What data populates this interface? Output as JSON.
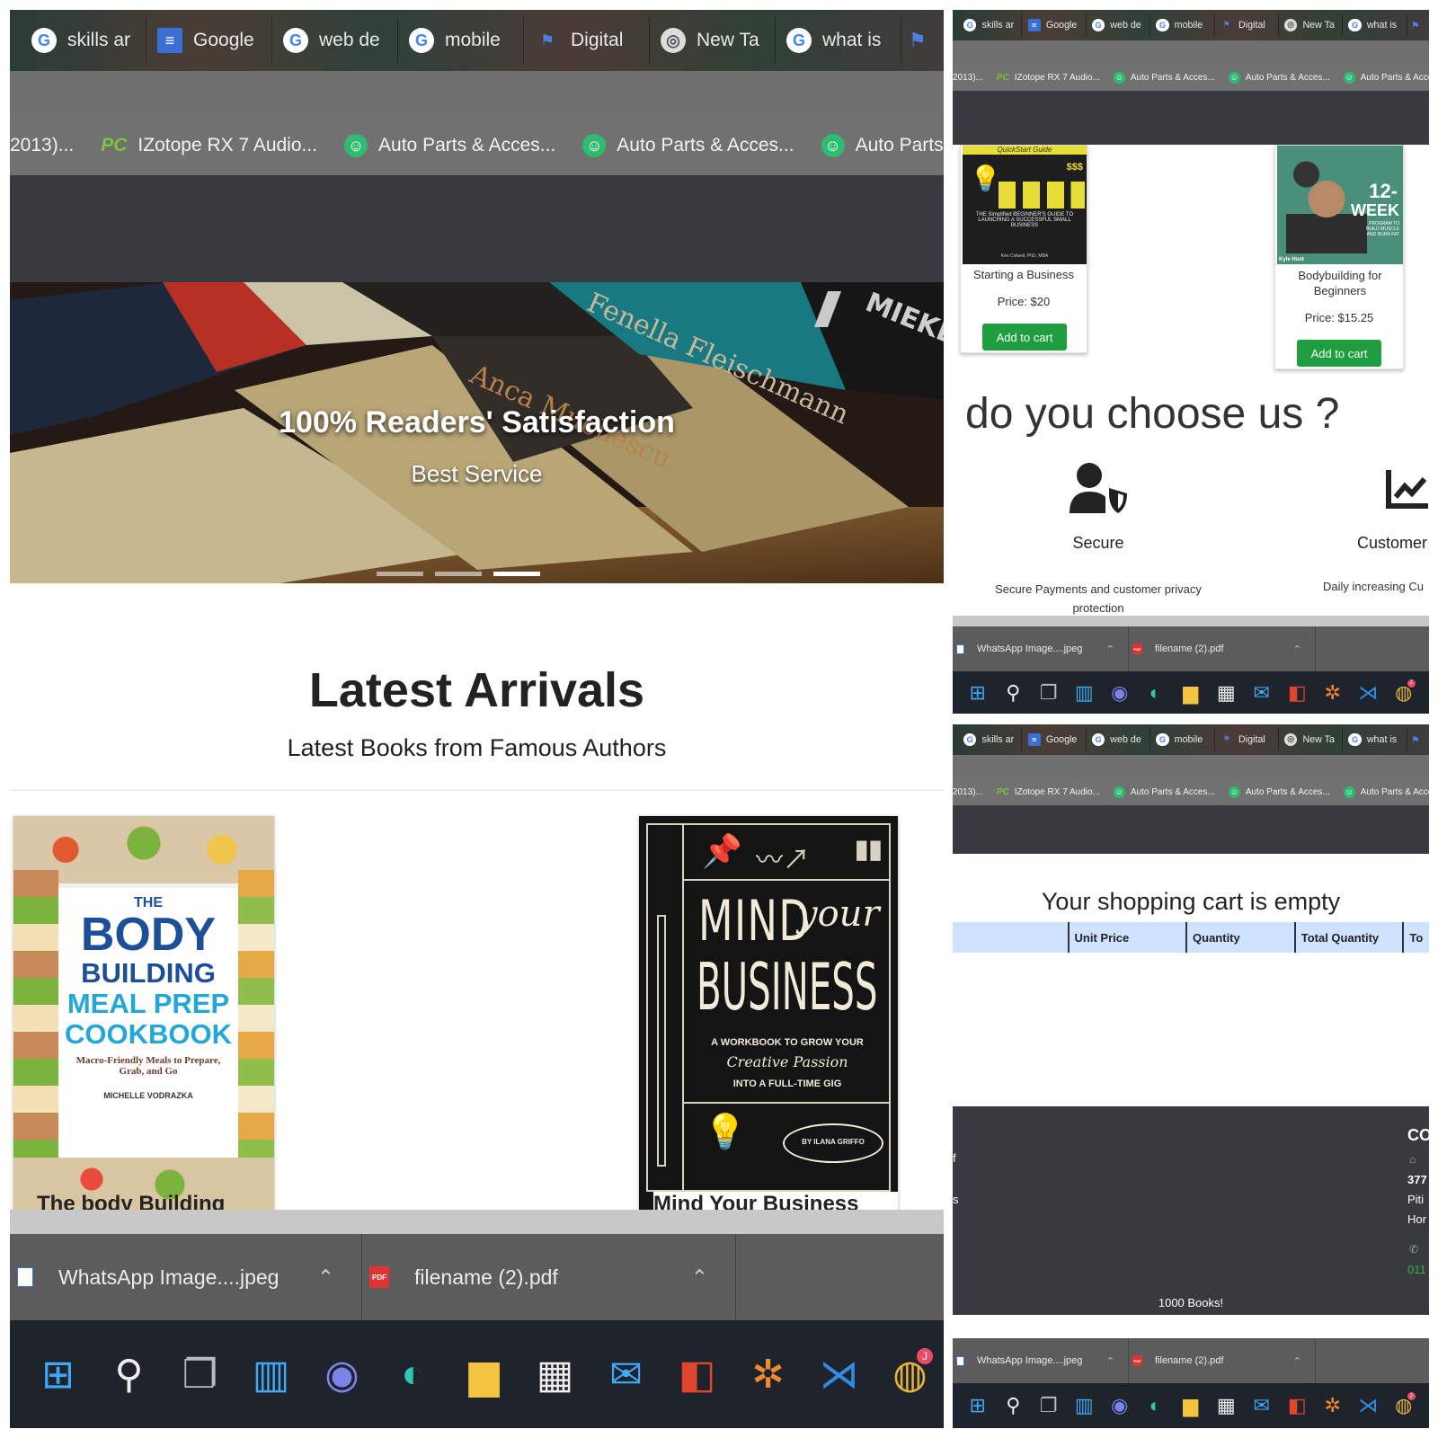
{
  "browser": {
    "tabs": [
      "skills ar",
      "Google",
      "web de",
      "mobile",
      "Digital",
      "New Ta",
      "what is"
    ],
    "tab_icons": [
      "google-g-icon",
      "google-docs-icon",
      "google-g-icon",
      "google-g-icon",
      "flag-icon",
      "chrome-icon",
      "google-g-icon"
    ],
    "bookmarks": [
      "2013)...",
      "IZotope RX 7 Audio...",
      "Auto Parts & Acces...",
      "Auto Parts & Acces...",
      "Auto Parts & Acces..."
    ],
    "bookmark_pc_glyph": "PC"
  },
  "home": {
    "hero": {
      "title": "100% Readers' Satisfaction",
      "subtitle": "Best Service",
      "book_spine_texts": [
        "Fenella Fleischmann",
        "Anca Muchescu",
        "MIEKE"
      ],
      "slide_count": 3,
      "active_slide": 3
    },
    "latest": {
      "title": "Latest Arrivals",
      "subtitle": "Latest Books from Famous Authors"
    },
    "books": [
      {
        "caption": "The body Building",
        "cover": {
          "the": "THE",
          "line1": "BODY",
          "line2": "BUILDING",
          "line3": "MEAL PREP",
          "line4": "COOKBOOK",
          "tagline": "Macro-Friendly Meals to Prepare, Grab, and Go",
          "author": "MICHELLE VODRAZKA"
        }
      },
      {
        "caption": "Mind Your Business",
        "cover": {
          "line1": "MIND",
          "script": "your",
          "line2": "BUSINESS",
          "tagline1": "A WORKBOOK TO GROW YOUR",
          "script2": "Creative Passion",
          "tagline2": "INTO A FULL-TIME GIG",
          "author": "BY ILANA GRIFFO"
        }
      }
    ]
  },
  "products": [
    {
      "title": "Starting a Business",
      "price": "Price: $20",
      "button": "Add to cart",
      "cover": {
        "top": "QuickStart Guide",
        "money": "$$$",
        "line": "THE Simplified BEGINNER'S GUIDE TO LAUNCHING A SUCCESSFUL SMALL BUSINESS",
        "author": "Ken Colwell, PhD, MBA"
      }
    },
    {
      "title": "Bodybuilding for Beginners",
      "price": "Price: $15.25",
      "button": "Add to cart",
      "cover": {
        "big": "12-",
        "word": "WEEK",
        "small": "PROGRAM TO BUILD MUSCLE AND BURN FAT",
        "author": "Kyle Hunt"
      }
    }
  ],
  "why": {
    "title": "do you choose us ?",
    "features": [
      {
        "icon": "user-shield-icon",
        "title": "Secure",
        "text": "Secure Payments and customer privacy protection"
      },
      {
        "icon": "chart-line-icon",
        "title": "Customer",
        "text": "Daily increasing Cu"
      }
    ]
  },
  "cart": {
    "empty_message": "Your shopping cart is empty",
    "columns": [
      "",
      "Unit Price",
      "Quantity",
      "Total Quantity",
      "To"
    ]
  },
  "footer": {
    "contact_heading": "CO",
    "address_lines": [
      "377",
      "Piti",
      "Hor"
    ],
    "phone": "011",
    "left_fragments": [
      "f",
      "s"
    ],
    "brand": "1000 Books!"
  },
  "downloads": [
    {
      "name": "WhatsApp Image....jpeg",
      "icon": "image-file-icon"
    },
    {
      "name": "filename (2).pdf",
      "icon": "pdf-file-icon"
    }
  ],
  "taskbar": {
    "icons": [
      "windows-start-icon",
      "search-icon",
      "task-view-icon",
      "widgets-icon",
      "teams-chat-icon",
      "edge-icon",
      "file-explorer-icon",
      "store-icon",
      "mail-icon",
      "office-icon",
      "xampp-icon",
      "vscode-icon",
      "chrome-icon"
    ],
    "chrome_badge": "J"
  },
  "colors": {
    "accent_green": "#1e9e3e",
    "table_head": "#cfe2ff",
    "dark_nav": "#383a3f",
    "bookmark_bar": "#717171",
    "taskbar": "#1f232b",
    "download_bar": "#5c5c5c"
  }
}
